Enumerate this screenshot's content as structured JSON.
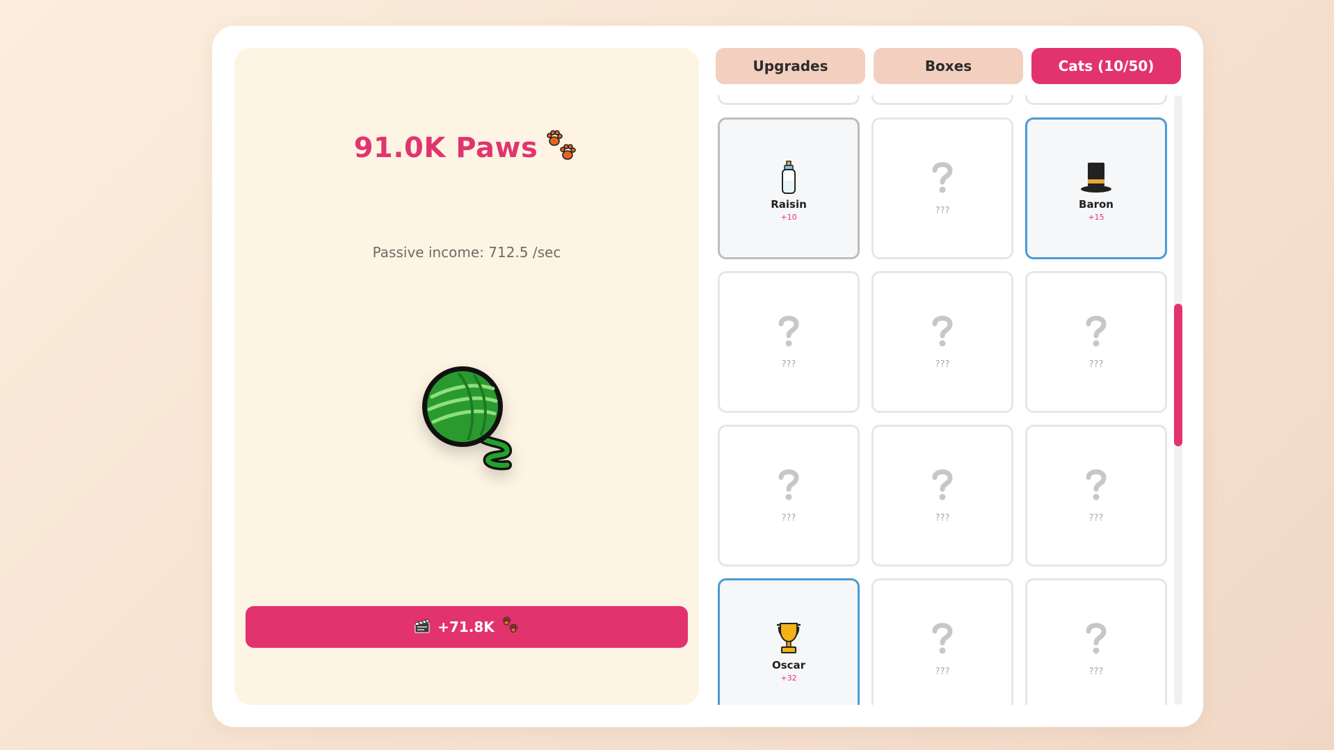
{
  "game": {
    "paws_display": "91.0K Paws",
    "passive_income": "Passive income: 712.5 /sec",
    "click_target": "yarn-ball-icon",
    "ad_reward": {
      "icon": "clapper-board-icon",
      "label": "+71.8K",
      "currency_icon": "paw-prints-icon"
    }
  },
  "tabs": [
    {
      "label": "Upgrades",
      "active": false
    },
    {
      "label": "Boxes",
      "active": false
    },
    {
      "label": "Cats (10/50)",
      "active": true
    }
  ],
  "cats": [
    {
      "state": "owned",
      "name": "Raisin",
      "bonus": "+10",
      "icon": "baby-bottle-icon"
    },
    {
      "state": "locked",
      "label": "???",
      "icon": "question-mark-icon"
    },
    {
      "state": "owned",
      "rarity": "rare",
      "name": "Baron",
      "bonus": "+15",
      "icon": "top-hat-icon"
    },
    {
      "state": "locked",
      "label": "???",
      "icon": "question-mark-icon"
    },
    {
      "state": "locked",
      "label": "???",
      "icon": "question-mark-icon"
    },
    {
      "state": "locked",
      "label": "???",
      "icon": "question-mark-icon"
    },
    {
      "state": "locked",
      "label": "???",
      "icon": "question-mark-icon"
    },
    {
      "state": "locked",
      "label": "???",
      "icon": "question-mark-icon"
    },
    {
      "state": "locked",
      "label": "???",
      "icon": "question-mark-icon"
    },
    {
      "state": "owned",
      "rarity": "rare",
      "name": "Oscar",
      "bonus": "+32",
      "icon": "trophy-icon"
    },
    {
      "state": "locked",
      "label": "???",
      "icon": "question-mark-icon"
    },
    {
      "state": "locked",
      "label": "???",
      "icon": "question-mark-icon"
    }
  ],
  "colors": {
    "accent": "#e2336e",
    "tab_inactive": "#f3cfbf",
    "panel_bg": "#fdf4e3",
    "rare_border": "#4b9ad4"
  }
}
